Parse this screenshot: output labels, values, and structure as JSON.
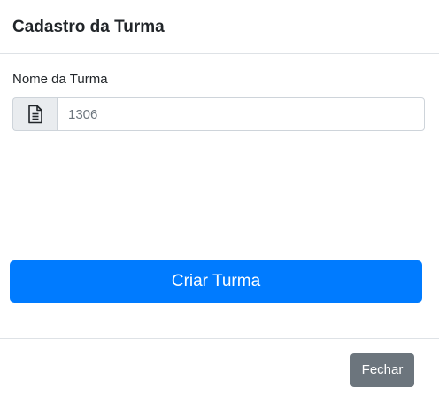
{
  "modal": {
    "title": "Cadastro da Turma"
  },
  "form": {
    "field_label": "Nome da Turma",
    "field_icon": "document-icon",
    "field_value": "",
    "field_placeholder": "1306"
  },
  "actions": {
    "submit_label": "Criar Turma",
    "close_label": "Fechar"
  },
  "colors": {
    "primary": "#007bff",
    "secondary": "#6c757d",
    "border": "#dee2e6",
    "input_addon_bg": "#e9ecef"
  }
}
